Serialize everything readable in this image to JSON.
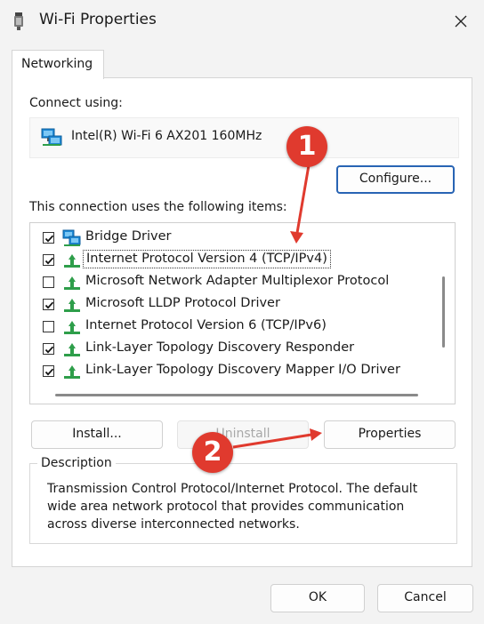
{
  "window": {
    "title": "Wi-Fi Properties",
    "close_icon": "close-icon"
  },
  "tab": {
    "label": "Networking"
  },
  "connect_using": {
    "label": "Connect using:",
    "adapter": "Intel(R) Wi-Fi 6 AX201 160MHz",
    "configure_label": "Configure..."
  },
  "items": {
    "label": "This connection uses the following items:",
    "rows": [
      {
        "label": "Bridge Driver",
        "checked": true,
        "icon": "network-adapter-icon"
      },
      {
        "label": "Internet Protocol Version 4 (TCP/IPv4)",
        "checked": true,
        "selected": true,
        "icon": "protocol-icon"
      },
      {
        "label": "Microsoft Network Adapter Multiplexor Protocol",
        "checked": false,
        "icon": "protocol-icon"
      },
      {
        "label": "Microsoft LLDP Protocol Driver",
        "checked": true,
        "icon": "protocol-icon"
      },
      {
        "label": "Internet Protocol Version 6 (TCP/IPv6)",
        "checked": false,
        "icon": "protocol-icon"
      },
      {
        "label": "Link-Layer Topology Discovery Responder",
        "checked": true,
        "icon": "protocol-icon"
      },
      {
        "label": "Link-Layer Topology Discovery Mapper I/O Driver",
        "checked": true,
        "icon": "protocol-icon"
      }
    ]
  },
  "actions": {
    "install": "Install...",
    "uninstall": "Uninstall",
    "properties": "Properties"
  },
  "description": {
    "title": "Description",
    "text": "Transmission Control Protocol/Internet Protocol. The default wide area network protocol that provides communication across diverse interconnected networks."
  },
  "footer": {
    "ok": "OK",
    "cancel": "Cancel"
  },
  "annotations": {
    "step1": "1",
    "step2": "2",
    "color": "#e03a2e"
  },
  "colors": {
    "focus_border": "#2864b4",
    "protocol_green": "#2e9e4a",
    "adapter_blue": "#1f8ad6"
  }
}
